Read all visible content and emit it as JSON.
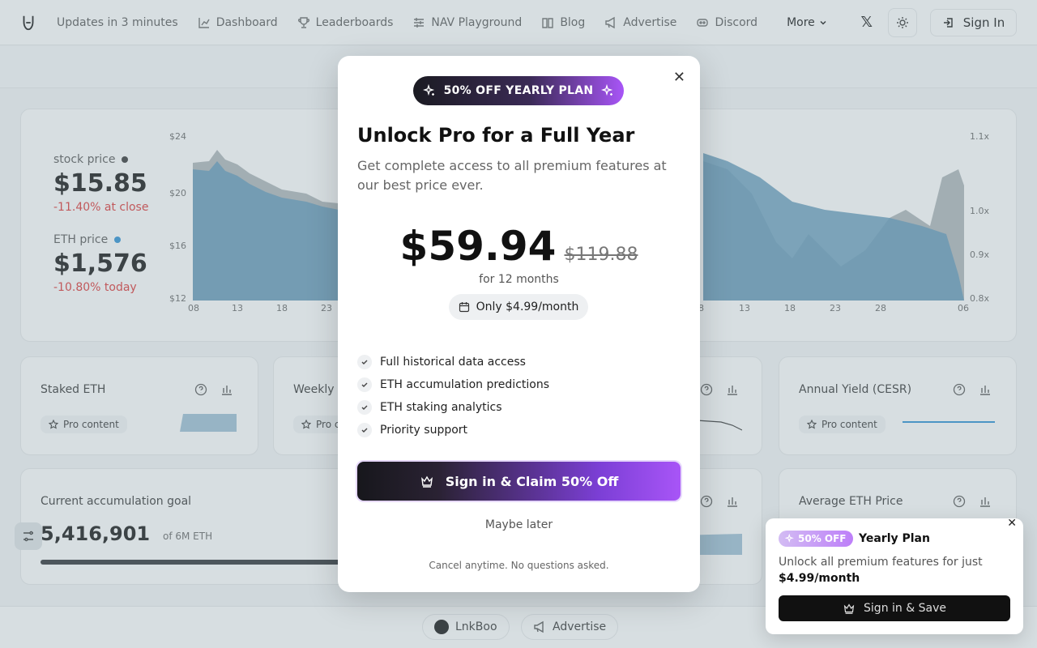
{
  "nav": {
    "updates": "Updates in 3 minutes",
    "items": [
      "Dashboard",
      "Leaderboards",
      "NAV Playground",
      "Blog",
      "Advertise",
      "Discord"
    ],
    "more": "More",
    "signin": "Sign In"
  },
  "main": {
    "stock_label": "stock price",
    "stock_value": "$15.85",
    "stock_change": "-11.40% at close",
    "eth_label": "ETH price",
    "eth_value": "$1,576",
    "eth_change": "-10.80% today",
    "left_yticks": [
      "$24",
      "$20",
      "$16",
      "$12"
    ],
    "right_yticks": [
      "1.1x",
      "1.0x",
      "0.9x",
      "0.8x"
    ],
    "xticks_left": [
      "08",
      "13",
      "18",
      "23"
    ],
    "xticks_right": [
      "8",
      "13",
      "18",
      "23",
      "28",
      "06"
    ]
  },
  "cards": {
    "staked": "Staked ETH",
    "weekly": "Weekly",
    "annual": "Annual Yield (CESR)",
    "pro": "Pro content",
    "pro_short": "Pro c",
    "goal_label": "Current accumulation goal",
    "goal_value": "5,416,901",
    "goal_of": "of 6M ETH",
    "avg_price": "Average ETH Price"
  },
  "modal": {
    "badge": "50% OFF YEARLY PLAN",
    "title": "Unlock Pro for a Full Year",
    "subtitle": "Get complete access to all premium features at our best price ever.",
    "price": "$59.94",
    "old_price": "$119.88",
    "period": "for 12 months",
    "monthly": "Only $4.99/month",
    "features": [
      "Full historical data access",
      "ETH accumulation predictions",
      "ETH staking analytics",
      "Priority support"
    ],
    "cta": "Sign in & Claim 50% Off",
    "later": "Maybe later",
    "cancel": "Cancel anytime. No questions asked."
  },
  "toast": {
    "badge": "50% OFF",
    "title": "Yearly Plan",
    "desc": "Unlock all premium features for just",
    "desc_price": "$4.99/month",
    "button": "Sign in & Save"
  },
  "footer": {
    "lnk": "LnkBoo",
    "advertise": "Advertise"
  }
}
